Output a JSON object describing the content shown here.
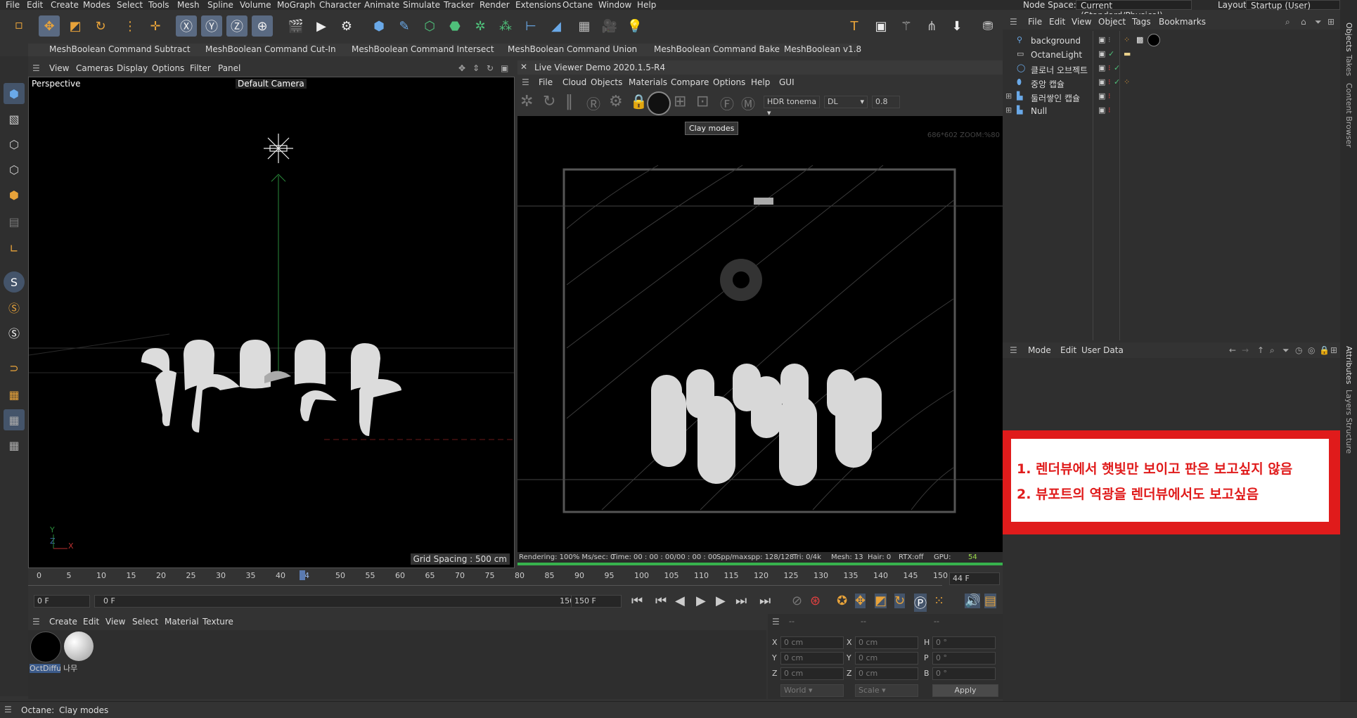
{
  "menubar": {
    "items": [
      "File",
      "Edit",
      "Create",
      "Modes",
      "Select",
      "Tools",
      "Mesh",
      "Spline",
      "Volume",
      "MoGraph",
      "Character",
      "Animate",
      "Simulate",
      "Tracker",
      "Render",
      "Extensions",
      "Octane",
      "Window",
      "Help"
    ],
    "node_space_label": "Node Space:",
    "node_space_value": "Current (Standard/Physical)",
    "layout_label": "Layout:",
    "layout_value": "Startup (User)"
  },
  "plugins": {
    "items": [
      "MeshBoolean Command Subtract",
      "MeshBoolean Command Cut-In",
      "MeshBoolean Command Intersect",
      "MeshBoolean Command Union",
      "MeshBoolean Command Bake",
      "MeshBoolean v1.8"
    ]
  },
  "viewport": {
    "menu": [
      "View",
      "Cameras",
      "Display",
      "Options",
      "Filter",
      "Panel"
    ],
    "label": "Perspective",
    "camera": "Default Camera",
    "grid_spacing": "Grid Spacing : 500 cm",
    "axis_y": "Y",
    "axis_z": "Z",
    "axis_x": "X"
  },
  "live_viewer": {
    "title": "Live Viewer Demo 2020.1.5-R4",
    "menu": [
      "File",
      "Cloud",
      "Objects",
      "Materials",
      "Compare",
      "Options",
      "Help",
      "GUI"
    ],
    "tonemap": "HDR tonema",
    "mode": "DL",
    "value": "0.8",
    "tooltip": "Clay modes",
    "zoom_info": "686*602 ZOOM:%80",
    "status": {
      "rendering": "Rendering: 100% Ms/sec: 0",
      "time": "Time: 00 : 00 : 00/00 : 00 : 00",
      "spp": "Spp/maxspp: 128/128",
      "tri": "Tri: 0/4k",
      "mesh": "Mesh: 13",
      "hair": "Hair: 0",
      "rtx": "RTX:off",
      "gpu": "GPU:",
      "gpu_val": "54"
    }
  },
  "timeline": {
    "ticks": [
      "0",
      "5",
      "10",
      "15",
      "20",
      "25",
      "30",
      "35",
      "40",
      "44",
      "50",
      "55",
      "60",
      "65",
      "70",
      "75",
      "80",
      "85",
      "90",
      "95",
      "100",
      "105",
      "110",
      "115",
      "120",
      "125",
      "130",
      "135",
      "140",
      "145",
      "150"
    ],
    "current_frame": "44 F",
    "start": "0 F",
    "start2": "0 F",
    "end": "150 F",
    "end2": "150 F"
  },
  "material_menu": [
    "Create",
    "Edit",
    "View",
    "Select",
    "Material",
    "Texture"
  ],
  "materials": [
    {
      "label": "OctDiffu",
      "color": "#000000"
    },
    {
      "label": "나무",
      "color": "#dddddd"
    }
  ],
  "coords": {
    "headers": [
      "--",
      "--",
      "--"
    ],
    "rows": [
      {
        "a": "X",
        "av": "0 cm",
        "b": "X",
        "bv": "0 cm",
        "c": "H",
        "cv": "0 °"
      },
      {
        "a": "Y",
        "av": "0 cm",
        "b": "Y",
        "bv": "0 cm",
        "c": "P",
        "cv": "0 °"
      },
      {
        "a": "Z",
        "av": "0 cm",
        "b": "Z",
        "bv": "0 cm",
        "c": "B",
        "cv": "0 °"
      }
    ],
    "world": "World",
    "scale": "Scale",
    "apply": "Apply"
  },
  "object_manager": {
    "menu": [
      "File",
      "Edit",
      "View",
      "Object",
      "Tags",
      "Bookmarks"
    ],
    "objects": [
      "background",
      "OctaneLight",
      "클로너 오브젝트",
      "중앙 캡슐",
      "둘러쌓인 캡슐",
      "Null"
    ]
  },
  "attributes": {
    "menu": [
      "Mode",
      "Edit",
      "User Data"
    ]
  },
  "right_tabs": [
    "Objects",
    "Takes",
    "Content Browser",
    "Attributes",
    "Layers",
    "Structure"
  ],
  "annotation": {
    "line1": "1. 렌더뷰에서 햇빛만 보이고 판은 보고싶지 않음",
    "line2": "2. 뷰포트의 역광을 렌더뷰에서도 보고싶음"
  },
  "statusbar": {
    "label": "Octane:",
    "text": "Clay modes"
  }
}
